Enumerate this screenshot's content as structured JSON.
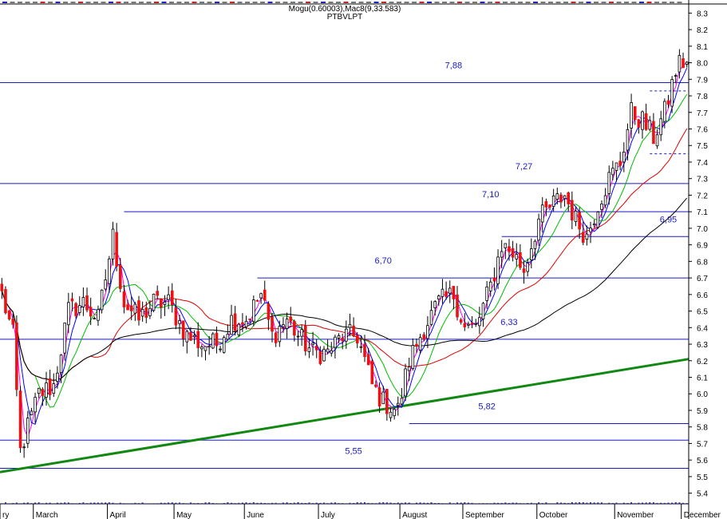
{
  "chart_data": {
    "type": "candlestick",
    "header_line": "Mogu(0.60003),Mac8(9,33.583)",
    "symbol": "PTBVLPT",
    "ylim": [
      5.35,
      8.35
    ],
    "y_ticks": [
      "8.3",
      "8.2",
      "8.1",
      "8.0",
      "7.9",
      "7.8",
      "7.7",
      "7.6",
      "7.5",
      "7.4",
      "7.3",
      "7.2",
      "7.1",
      "7.0",
      "6.9",
      "6.8",
      "6.7",
      "6.6",
      "6.5",
      "6.4",
      "6.3",
      "6.2",
      "6.1",
      "6.0",
      "5.9",
      "5.8",
      "5.7",
      "5.6",
      "5.5",
      "5.4"
    ],
    "month_labels": [
      {
        "label": "ry",
        "index": 0
      },
      {
        "label": "March",
        "index": 9
      },
      {
        "label": "April",
        "index": 29
      },
      {
        "label": "May",
        "index": 47
      },
      {
        "label": "June",
        "index": 66
      },
      {
        "label": "July",
        "index": 86
      },
      {
        "label": "August",
        "index": 108
      },
      {
        "label": "September",
        "index": 125
      },
      {
        "label": "October",
        "index": 145
      },
      {
        "label": "November",
        "index": 166
      },
      {
        "label": "December",
        "index": 184
      }
    ],
    "num_bars": 186,
    "anchors": [
      [
        0,
        6.6
      ],
      [
        3,
        6.35
      ],
      [
        5,
        5.65
      ],
      [
        7,
        5.8
      ],
      [
        10,
        6.0
      ],
      [
        14,
        6.05
      ],
      [
        18,
        6.5
      ],
      [
        22,
        6.55
      ],
      [
        26,
        6.45
      ],
      [
        30,
        6.95
      ],
      [
        33,
        6.55
      ],
      [
        37,
        6.45
      ],
      [
        41,
        6.55
      ],
      [
        45,
        6.55
      ],
      [
        50,
        6.35
      ],
      [
        54,
        6.3
      ],
      [
        58,
        6.3
      ],
      [
        62,
        6.45
      ],
      [
        66,
        6.45
      ],
      [
        70,
        6.6
      ],
      [
        73,
        6.35
      ],
      [
        77,
        6.45
      ],
      [
        80,
        6.35
      ],
      [
        84,
        6.25
      ],
      [
        88,
        6.25
      ],
      [
        92,
        6.35
      ],
      [
        96,
        6.35
      ],
      [
        100,
        6.05
      ],
      [
        103,
        5.95
      ],
      [
        107,
        5.9
      ],
      [
        110,
        6.2
      ],
      [
        114,
        6.4
      ],
      [
        118,
        6.55
      ],
      [
        122,
        6.6
      ],
      [
        125,
        6.4
      ],
      [
        128,
        6.4
      ],
      [
        132,
        6.65
      ],
      [
        135,
        6.9
      ],
      [
        138,
        6.85
      ],
      [
        141,
        6.75
      ],
      [
        145,
        7.05
      ],
      [
        149,
        7.15
      ],
      [
        152,
        7.2
      ],
      [
        155,
        7.05
      ],
      [
        158,
        6.95
      ],
      [
        161,
        7.15
      ],
      [
        164,
        7.3
      ],
      [
        167,
        7.4
      ],
      [
        170,
        7.7
      ],
      [
        173,
        7.65
      ],
      [
        176,
        7.55
      ],
      [
        179,
        7.7
      ],
      [
        182,
        7.95
      ],
      [
        183,
        8.0
      ],
      [
        184,
        8.0
      ]
    ],
    "moving_averages": [
      {
        "period": 3,
        "color": "#ff00ff"
      },
      {
        "period": 5,
        "color": "#0000ff"
      },
      {
        "period": 10,
        "color": "#00bb00"
      },
      {
        "period": 25,
        "color": "#dd0000"
      },
      {
        "period": 60,
        "color": "#000000"
      }
    ],
    "levels": [
      {
        "value": 7.88,
        "label": "7,88",
        "from_index": 0,
        "to_index": 186,
        "label_index": 122
      },
      {
        "value": 7.27,
        "label": "7,27",
        "from_index": 0,
        "to_index": 186,
        "label_index": 141
      },
      {
        "value": 7.1,
        "label": "7,10",
        "from_index": 33,
        "to_index": 186,
        "label_index": 132
      },
      {
        "value": 6.95,
        "label": "6,95",
        "from_index": 135,
        "to_index": 186,
        "label_index": 180
      },
      {
        "value": 6.7,
        "label": "6,70",
        "from_index": 69,
        "to_index": 186,
        "label_index": 103
      },
      {
        "value": 6.33,
        "label": "6,33",
        "from_index": 0,
        "to_index": 186,
        "label_index": 137
      },
      {
        "value": 5.82,
        "label": "5,82",
        "from_index": 110,
        "to_index": 186,
        "label_index": 131
      },
      {
        "value": 5.72,
        "label": "",
        "from_index": 0,
        "to_index": 186,
        "label_index": 0
      },
      {
        "value": 5.55,
        "label": "5,55",
        "from_index": 0,
        "to_index": 186,
        "label_index": 95
      }
    ],
    "dashed_levels": [
      {
        "value": 7.83,
        "from_index": 175,
        "to_index": 186
      },
      {
        "value": 7.45,
        "from_index": 175,
        "to_index": 186
      }
    ],
    "trendline": {
      "from": {
        "index": 3,
        "value": 5.54
      },
      "to": {
        "index": 186,
        "value": 6.21
      }
    },
    "colors": {
      "up": "#ffffff",
      "down": "#ee1111",
      "candle_outline": "#000000",
      "level_line": "#1a1ac8",
      "trendline": "#118811",
      "border": "#000000"
    }
  }
}
